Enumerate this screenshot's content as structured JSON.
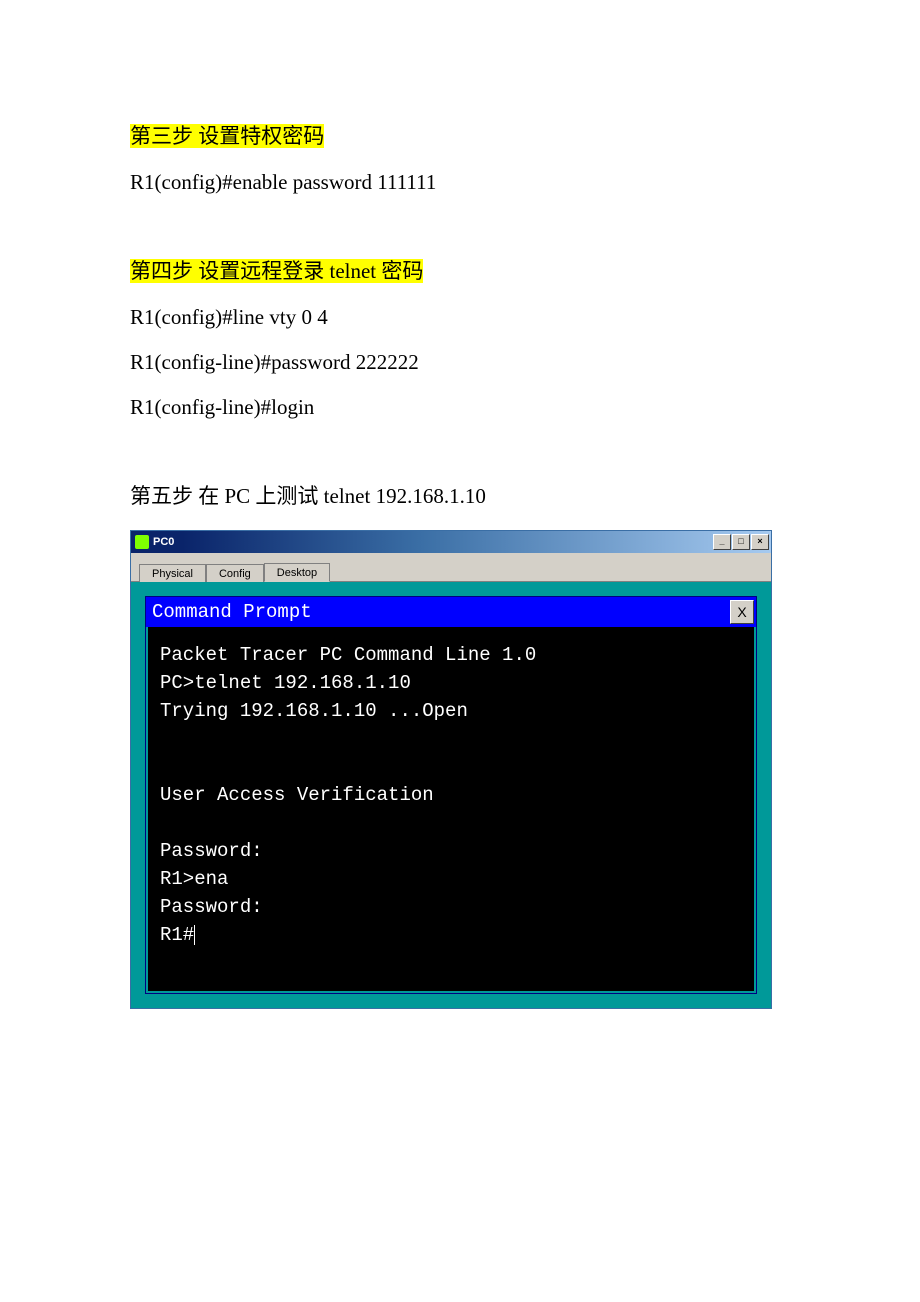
{
  "step3": {
    "heading": "第三步   设置特权密码",
    "cmd1": "R1(config)#enable password 111111"
  },
  "step4": {
    "heading": "第四步   设置远程登录 telnet 密码",
    "cmd1": "R1(config)#line vty 0 4",
    "cmd2": "R1(config-line)#password 222222",
    "cmd3": "R1(config-line)#login"
  },
  "step5": {
    "heading": "第五步  在 PC 上测试 telnet 192.168.1.10"
  },
  "pt_window": {
    "title": "PC0",
    "tabs": {
      "physical": "Physical",
      "config": "Config",
      "desktop": "Desktop"
    },
    "controls": {
      "min": "_",
      "max": "□",
      "close": "×"
    }
  },
  "cmd_prompt": {
    "title": "Command Prompt",
    "close": "X",
    "lines": [
      "Packet Tracer PC Command Line 1.0",
      "PC>telnet 192.168.1.10",
      "Trying 192.168.1.10 ...Open",
      "",
      "",
      "User Access Verification",
      "",
      "Password:",
      "R1>ena",
      "Password:",
      "R1#"
    ]
  }
}
